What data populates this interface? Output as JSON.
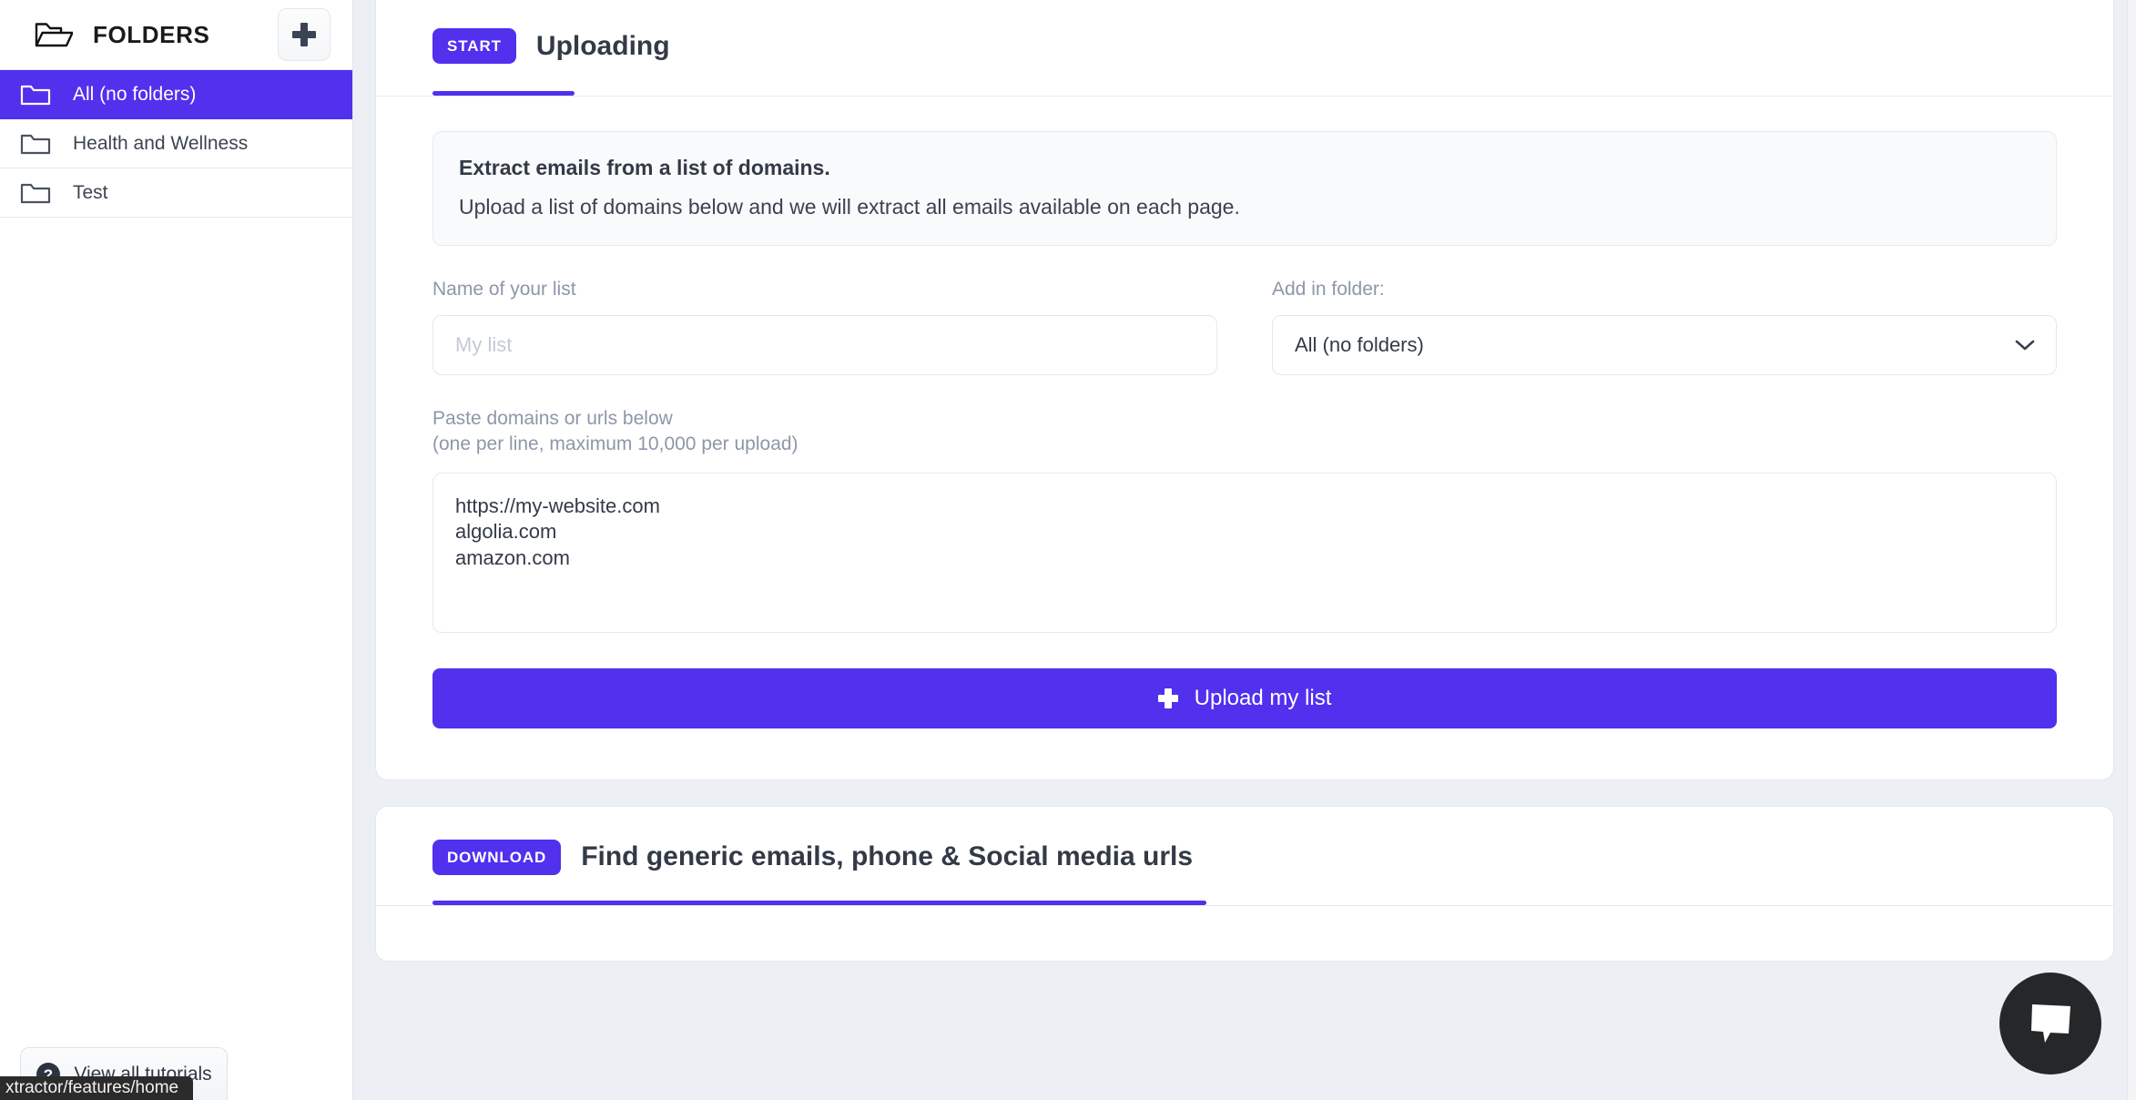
{
  "sidebar": {
    "header_title": "FOLDERS",
    "add_button_label": "+",
    "folders": [
      {
        "label": "All (no folders)",
        "active": true
      },
      {
        "label": "Health and Wellness",
        "active": false
      },
      {
        "label": "Test",
        "active": false
      }
    ],
    "tutorials_label": "View all tutorials",
    "status_bar_text": "xtractor/features/home"
  },
  "upload_card": {
    "badge": "START",
    "title": "Uploading",
    "notice_title": "Extract emails from a list of domains.",
    "notice_sub": "Upload a list of domains below and we will extract all emails available on each page.",
    "name_label": "Name of your list",
    "name_value": "",
    "name_placeholder": "My list",
    "folder_label": "Add in folder:",
    "folder_value": "All (no folders)",
    "paste_label_line1": "Paste domains or urls below",
    "paste_label_line2": "(one per line, maximum 10,000 per upload)",
    "domains_value": "https://my-website.com\nalgolia.com\namazon.com",
    "upload_button_label": "Upload my list"
  },
  "download_card": {
    "badge": "DOWNLOAD",
    "title": "Find generic emails, phone & Social media urls"
  },
  "colors": {
    "accent": "#5130ee",
    "page_bg": "#eceff4",
    "card_bg": "#ffffff",
    "notice_bg": "#f8fafc",
    "chat_bg": "#262729"
  }
}
